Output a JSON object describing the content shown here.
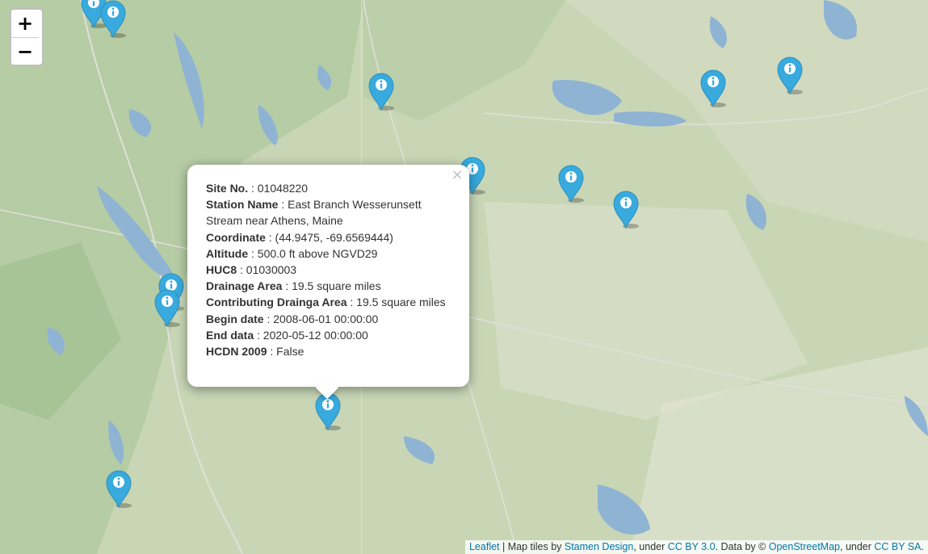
{
  "zoom": {
    "in_label": "+",
    "out_label": "−"
  },
  "marker": {
    "icon": "info-circle-icon",
    "color": "#38aadd",
    "glyph": "i"
  },
  "markers_count": 16,
  "popup": {
    "close_label": "×",
    "rows": [
      {
        "key": "Site No.",
        "value": ": 01048220"
      },
      {
        "key": "Station Name",
        "value": ": East Branch Wesserunsett Stream near Athens, Maine"
      },
      {
        "key": "Coordinate",
        "value": ": (44.9475, -69.6569444)"
      },
      {
        "key": "Altitude",
        "value": ": 500.0 ft above NGVD29"
      },
      {
        "key": "HUC8",
        "value": ": 01030003"
      },
      {
        "key": "Drainage Area",
        "value": ": 19.5 square miles"
      },
      {
        "key": "Contributing Drainga Area",
        "value": ": 19.5 square miles"
      },
      {
        "key": "Begin date",
        "value": ": 2008-06-01 00:00:00"
      },
      {
        "key": "End data",
        "value": ": 2020-05-12 00:00:00"
      },
      {
        "key": "HCDN 2009",
        "value": ": False"
      }
    ]
  },
  "attribution": {
    "leaflet": "Leaflet",
    "sep1": " | Map tiles by ",
    "stamen": "Stamen Design",
    "sep2": ", under ",
    "ccby": "CC BY 3.0",
    "sep3": ". Data by © ",
    "osm": "OpenStreetMap",
    "sep4": ", under ",
    "ccbysa": "CC BY SA",
    "end": "."
  },
  "colors": {
    "water": "#8fb3d3",
    "land": "#c9d7b8",
    "link": "#0078a8"
  }
}
